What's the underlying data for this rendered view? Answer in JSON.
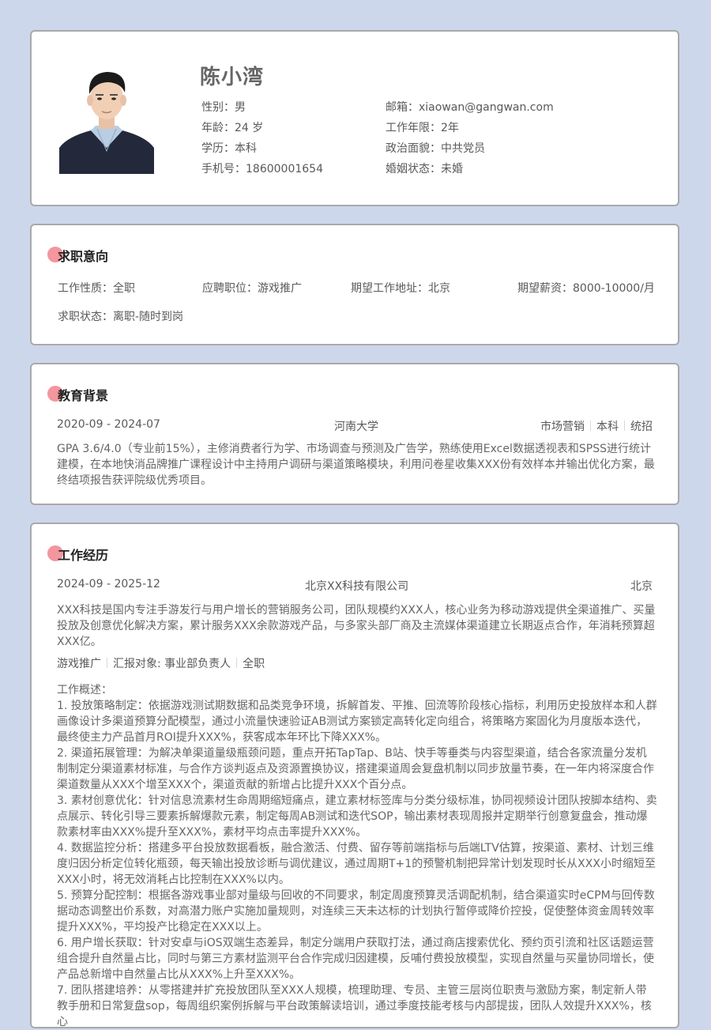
{
  "profile": {
    "name": "陈小湾",
    "left": [
      {
        "label": "性别：",
        "value": "男"
      },
      {
        "label": "年龄：",
        "value": "24 岁"
      },
      {
        "label": "学历：",
        "value": "本科"
      },
      {
        "label": "手机号：",
        "value": "18600001654"
      }
    ],
    "right": [
      {
        "label": "邮箱：",
        "value": "xiaowan@gangwan.com"
      },
      {
        "label": "工作年限：",
        "value": "2年"
      },
      {
        "label": "政治面貌：",
        "value": "中共党员"
      },
      {
        "label": "婚姻状态：",
        "value": "未婚"
      }
    ]
  },
  "intent": {
    "title": "求职意向",
    "fields": [
      {
        "label": "工作性质：",
        "value": "全职"
      },
      {
        "label": "应聘职位：",
        "value": "游戏推广"
      },
      {
        "label": "期望工作地址：",
        "value": "北京"
      },
      {
        "label": "期望薪资：",
        "value": "8000-10000/月"
      },
      {
        "label": "求职状态：",
        "value": "离职-随时到岗"
      }
    ]
  },
  "education": {
    "title": "教育背景",
    "period": "2020-09 - 2024-07",
    "school": "河南大学",
    "major": "市场营销",
    "degree": "本科",
    "type": "统招",
    "description": "GPA 3.6/4.0（专业前15%），主修消费者行为学、市场调查与预测及广告学，熟练使用Excel数据透视表和SPSS进行统计建模，在本地快消品牌推广课程设计中主持用户调研与渠道策略模块，利用问卷星收集XXX份有效样本并输出优化方案，最终结项报告获评院级优秀项目。"
  },
  "work": {
    "title": "工作经历",
    "period": "2024-09 - 2025-12",
    "company": "北京XX科技有限公司",
    "city": "北京",
    "company_desc": "XXX科技是国内专注手游发行与用户增长的营销服务公司，团队规模约XXX人，核心业务为移动游戏提供全渠道推广、买量投放及创意优化解决方案，累计服务XXX余款游戏产品，与多家头部厂商及主流媒体渠道建立长期返点合作，年消耗预算超XXX亿。",
    "tags": [
      "游戏推广",
      "汇报对象: 事业部负责人",
      "全职"
    ],
    "overview_label": "工作概述：",
    "items": [
      "1. 投放策略制定：依据游戏测试期数据和品类竞争环境，拆解首发、平推、回流等阶段核心指标，利用历史投放样本和人群画像设计多渠道预算分配模型，通过小流量快速验证AB测试方案锁定高转化定向组合，将策略方案固化为月度版本迭代，最终使主力产品首月ROI提升XXX%，获客成本年环比下降XXX%。",
      "2. 渠道拓展管理：为解决单渠道量级瓶颈问题，重点开拓TapTap、B站、快手等垂类与内容型渠道，结合各家流量分发机制制定分渠道素材标准，与合作方谈判返点及资源置换协议，搭建渠道周会复盘机制以同步放量节奏，在一年内将深度合作渠道数量从XXX个增至XXX个，渠道贡献的新增占比提升XXX个百分点。",
      "3. 素材创意优化：针对信息流素材生命周期缩短痛点，建立素材标签库与分类分级标准，协同视频设计团队按脚本结构、卖点展示、转化引导三要素拆解爆款元素，制定每周AB测试和迭代SOP，输出素材表现周报并定期举行创意复盘会，推动爆款素材率由XXX%提升至XXX%，素材平均点击率提升XXX%。",
      "4. 数据监控分析：搭建多平台投放数据看板，融合激活、付费、留存等前端指标与后端LTV估算，按渠道、素材、计划三维度归因分析定位转化瓶颈，每天输出投放诊断与调优建议，通过周期T+1的预警机制把异常计划发现时长从XXX小时缩短至XXX小时，将无效消耗占比控制在XXX%以内。",
      "5. 预算分配控制：根据各游戏事业部对量级与回收的不同要求，制定周度预算灵活调配机制，结合渠道实时eCPM与回传数据动态调整出价系数，对高潜力账户实施加量规则，对连续三天未达标的计划执行暂停或降价控投，促使整体资金周转效率提升XXX%，平均投产比稳定在XXX以上。",
      "6. 用户增长获取：针对安卓与iOS双端生态差异，制定分端用户获取打法，通过商店搜索优化、预约页引流和社区话题运营组合提升自然量占比，同时与第三方素材监测平台合作完成归因建模，反哺付费投放模型，实现自然量与买量协同增长，使产品总新增中自然量占比从XXX%上升至XXX%。",
      "7. 团队搭建培养：从零搭建并扩充投放团队至XXX人规模，梳理助理、专员、主管三层岗位职责与激励方案，制定新人带教手册和日常复盘sop，每周组织案例拆解与平台政策解读培训，通过季度技能考核与内部提拔，团队人效提升XXX%，核心"
    ]
  }
}
